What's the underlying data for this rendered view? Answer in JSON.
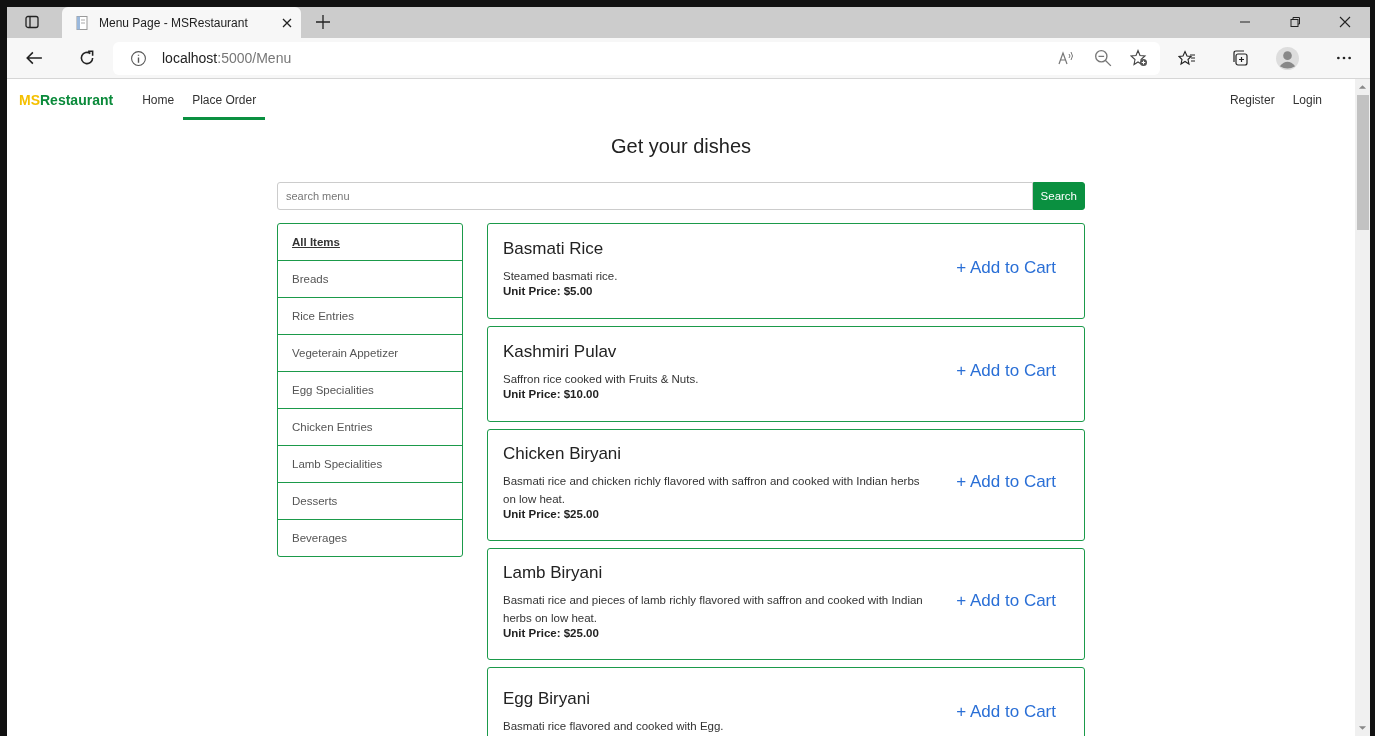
{
  "browser": {
    "tab_title": "Menu Page - MSRestaurant",
    "url_host": "localhost",
    "url_path": ":5000/Menu"
  },
  "navbar": {
    "brand_first": "MS",
    "brand_rest": "Restaurant",
    "links": [
      {
        "label": "Home",
        "selected": false
      },
      {
        "label": "Place Order",
        "selected": true
      }
    ],
    "right_links": [
      "Register",
      "Login"
    ]
  },
  "heading": "Get your dishes",
  "search": {
    "placeholder": "search menu",
    "button": "Search"
  },
  "categories": [
    {
      "label": "All Items",
      "selected": true
    },
    {
      "label": "Breads",
      "selected": false
    },
    {
      "label": "Rice Entries",
      "selected": false
    },
    {
      "label": "Vegeterain Appetizer",
      "selected": false
    },
    {
      "label": "Egg Specialities",
      "selected": false
    },
    {
      "label": "Chicken Entries",
      "selected": false
    },
    {
      "label": "Lamb Specialities",
      "selected": false
    },
    {
      "label": "Desserts",
      "selected": false
    },
    {
      "label": "Beverages",
      "selected": false
    }
  ],
  "dishes": [
    {
      "name": "Basmati Rice",
      "description": "Steamed basmati rice.",
      "price": "Unit Price: $5.00",
      "action": "+ Add to Cart"
    },
    {
      "name": "Kashmiri Pulav",
      "description": "Saffron rice cooked with Fruits & Nuts.",
      "price": "Unit Price: $10.00",
      "action": "+ Add to Cart"
    },
    {
      "name": "Chicken Biryani",
      "description": "Basmati rice and chicken richly flavored with saffron and cooked with Indian herbs on low heat.",
      "price": "Unit Price: $25.00",
      "action": "+ Add to Cart"
    },
    {
      "name": "Lamb Biryani",
      "description": "Basmati rice and pieces of lamb richly flavored with saffron and cooked with Indian herbs on low heat.",
      "price": "Unit Price: $25.00",
      "action": "+ Add to Cart"
    },
    {
      "name": "Egg Biryani",
      "description": "Basmati rice flavored and cooked with Egg.",
      "action": "+ Add to Cart"
    }
  ]
}
